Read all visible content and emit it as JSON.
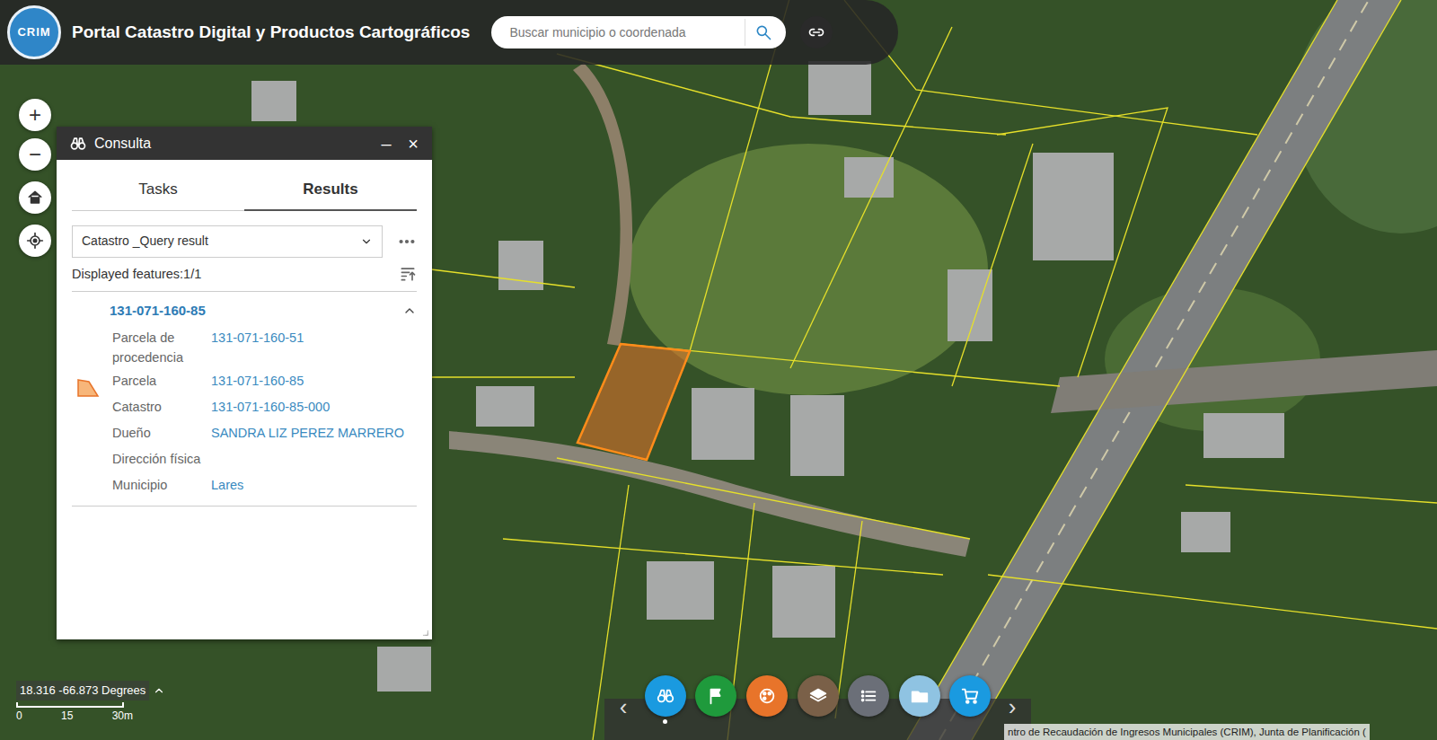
{
  "header": {
    "logo": "CRIM",
    "title": "Portal Catastro Digital y Productos Cartográficos",
    "search": {
      "placeholder": "Buscar municipio o coordenada"
    }
  },
  "map_controls": {
    "zoom_in": "+",
    "zoom_out": "−"
  },
  "panel": {
    "title": "Consulta",
    "minimize": "–",
    "close": "×",
    "tabs": [
      {
        "label": "Tasks",
        "selected": false
      },
      {
        "label": "Results",
        "selected": true
      }
    ],
    "layer_select": {
      "value": "Catastro _Query result"
    },
    "displayed": "Displayed features:1/1",
    "features": [
      {
        "title": "131-071-160-85",
        "expanded": true,
        "highlighted": true,
        "fields": [
          {
            "label": "Parcela de procedencia",
            "value": "131-071-160-51"
          },
          {
            "label": "Parcela",
            "value": "131-071-160-85"
          },
          {
            "label": "Catastro",
            "value": "131-071-160-85-000"
          },
          {
            "label": "Dueño",
            "value": "SANDRA LIZ PEREZ MARRERO"
          },
          {
            "label": "Dirección física",
            "value": ""
          },
          {
            "label": "Municipio",
            "value": "Lares"
          }
        ]
      }
    ]
  },
  "coordinates": "18.316 -66.873 Degrees",
  "scale": [
    "0",
    "15",
    "30m"
  ],
  "toolbar": {
    "prev": "‹",
    "next": "›",
    "buttons": [
      {
        "kind": "query",
        "color": "#1a9ae0",
        "selected": true
      },
      {
        "kind": "flag",
        "color": "#1f9a3c",
        "selected": false
      },
      {
        "kind": "palette",
        "color": "#e8742a",
        "selected": false
      },
      {
        "kind": "layers",
        "color": "#7a6048",
        "selected": false
      },
      {
        "kind": "list",
        "color": "#6b6f78",
        "selected": false
      },
      {
        "kind": "folder",
        "color": "#8fc3e2",
        "selected": false
      },
      {
        "kind": "cart",
        "color": "#1a9ae0",
        "selected": false
      }
    ]
  },
  "attribution": "ntro de Recaudación de Ingresos Municipales (CRIM), Junta de Planificación ("
}
